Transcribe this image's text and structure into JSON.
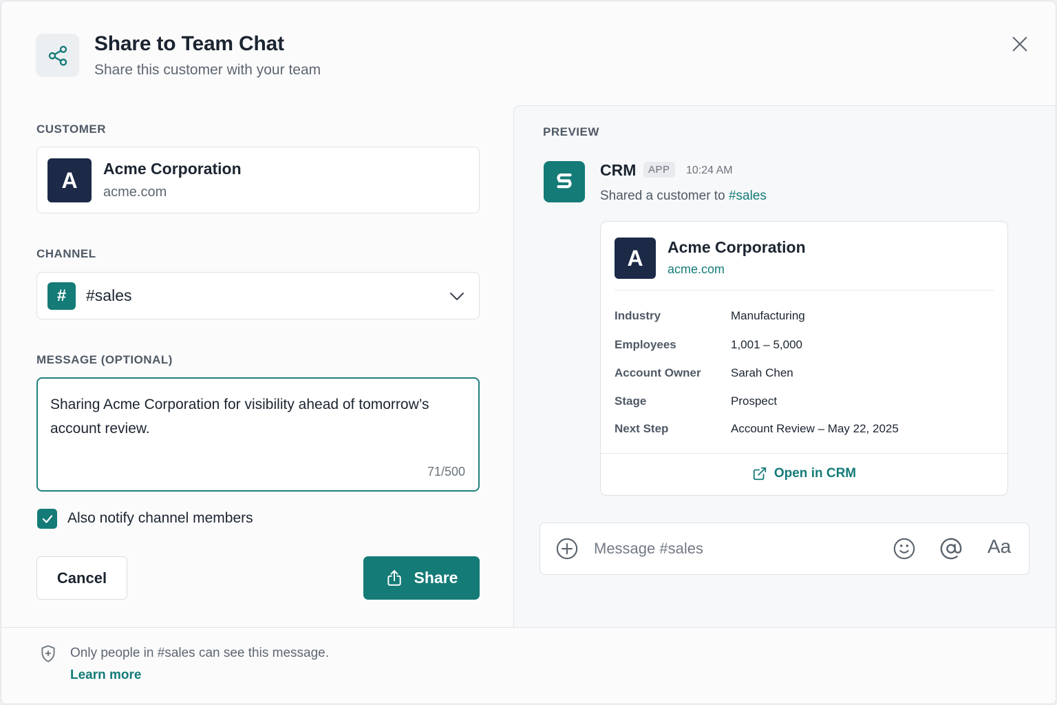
{
  "dialog": {
    "title": "Share to Team Chat",
    "subtitle": "Share this customer with your team",
    "header_icon": "share-icon",
    "close_icon": "close-icon"
  },
  "form": {
    "customer_label": "CUSTOMER",
    "customer": {
      "initial": "A",
      "name": "Acme Corporation",
      "domain": "acme.com"
    },
    "channel_label": "CHANNEL",
    "channel": {
      "hash_symbol": "#",
      "value": "#sales"
    },
    "message_label": "MESSAGE (OPTIONAL)",
    "message": {
      "value": "Sharing Acme Corporation for visibility ahead of tomorrow’s account review.",
      "counter": "71/500"
    },
    "notify": {
      "checked": true,
      "label": "Also notify channel members"
    },
    "cancel_label": "Cancel",
    "share_label": "Share"
  },
  "preview": {
    "label": "PREVIEW",
    "sender": "CRM",
    "badge": "APP",
    "time": "10:24 AM",
    "line_prefix": "Shared a customer to ",
    "line_channel": "#sales",
    "card": {
      "initial": "A",
      "name": "Acme Corporation",
      "domain": "acme.com",
      "fields": [
        {
          "key": "Industry",
          "value": "Manufacturing"
        },
        {
          "key": "Employees",
          "value": "1,001 – 5,000"
        },
        {
          "key": "Account Owner",
          "value": "Sarah Chen"
        },
        {
          "key": "Stage",
          "value": "Prospect"
        },
        {
          "key": "Next Step",
          "value": "Account Review – May 22, 2025"
        }
      ],
      "open_label": "Open in CRM"
    },
    "compose": {
      "placeholder": "Message #sales",
      "format_label": "Aa"
    }
  },
  "footer": {
    "notice": "Only people in #sales can see this message.",
    "link": "Learn more"
  },
  "colors": {
    "accent": "#147b77",
    "avatar_bg": "#1c2a47",
    "text_primary": "#1b2430",
    "text_secondary": "#5d6670"
  }
}
